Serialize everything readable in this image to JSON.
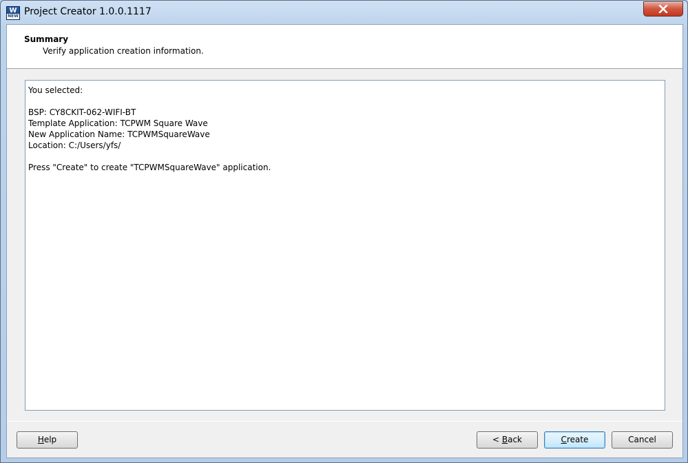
{
  "window": {
    "title": "Project Creator 1.0.0.1117",
    "icon": "app-new-icon",
    "icon_glyph": "W",
    "icon_badge": "NEW"
  },
  "header": {
    "title": "Summary",
    "subtitle": "Verify application creation information."
  },
  "summary": {
    "lines": [
      "You selected:",
      "",
      "BSP: CY8CKIT-062-WIFI-BT",
      "Template Application: TCPWM Square Wave",
      "New Application Name: TCPWMSquareWave",
      "Location: C:/Users/yfs/",
      "",
      "Press \"Create\" to create \"TCPWMSquareWave\" application."
    ]
  },
  "buttons": {
    "help": {
      "mnemonic": "H",
      "rest": "elp"
    },
    "back": {
      "prefix": "< ",
      "mnemonic": "B",
      "rest": "ack"
    },
    "create": {
      "mnemonic": "C",
      "rest": "reate"
    },
    "cancel": "Cancel"
  },
  "colors": {
    "close_button": "#c3381f",
    "default_button_border": "#3c7fb1"
  }
}
